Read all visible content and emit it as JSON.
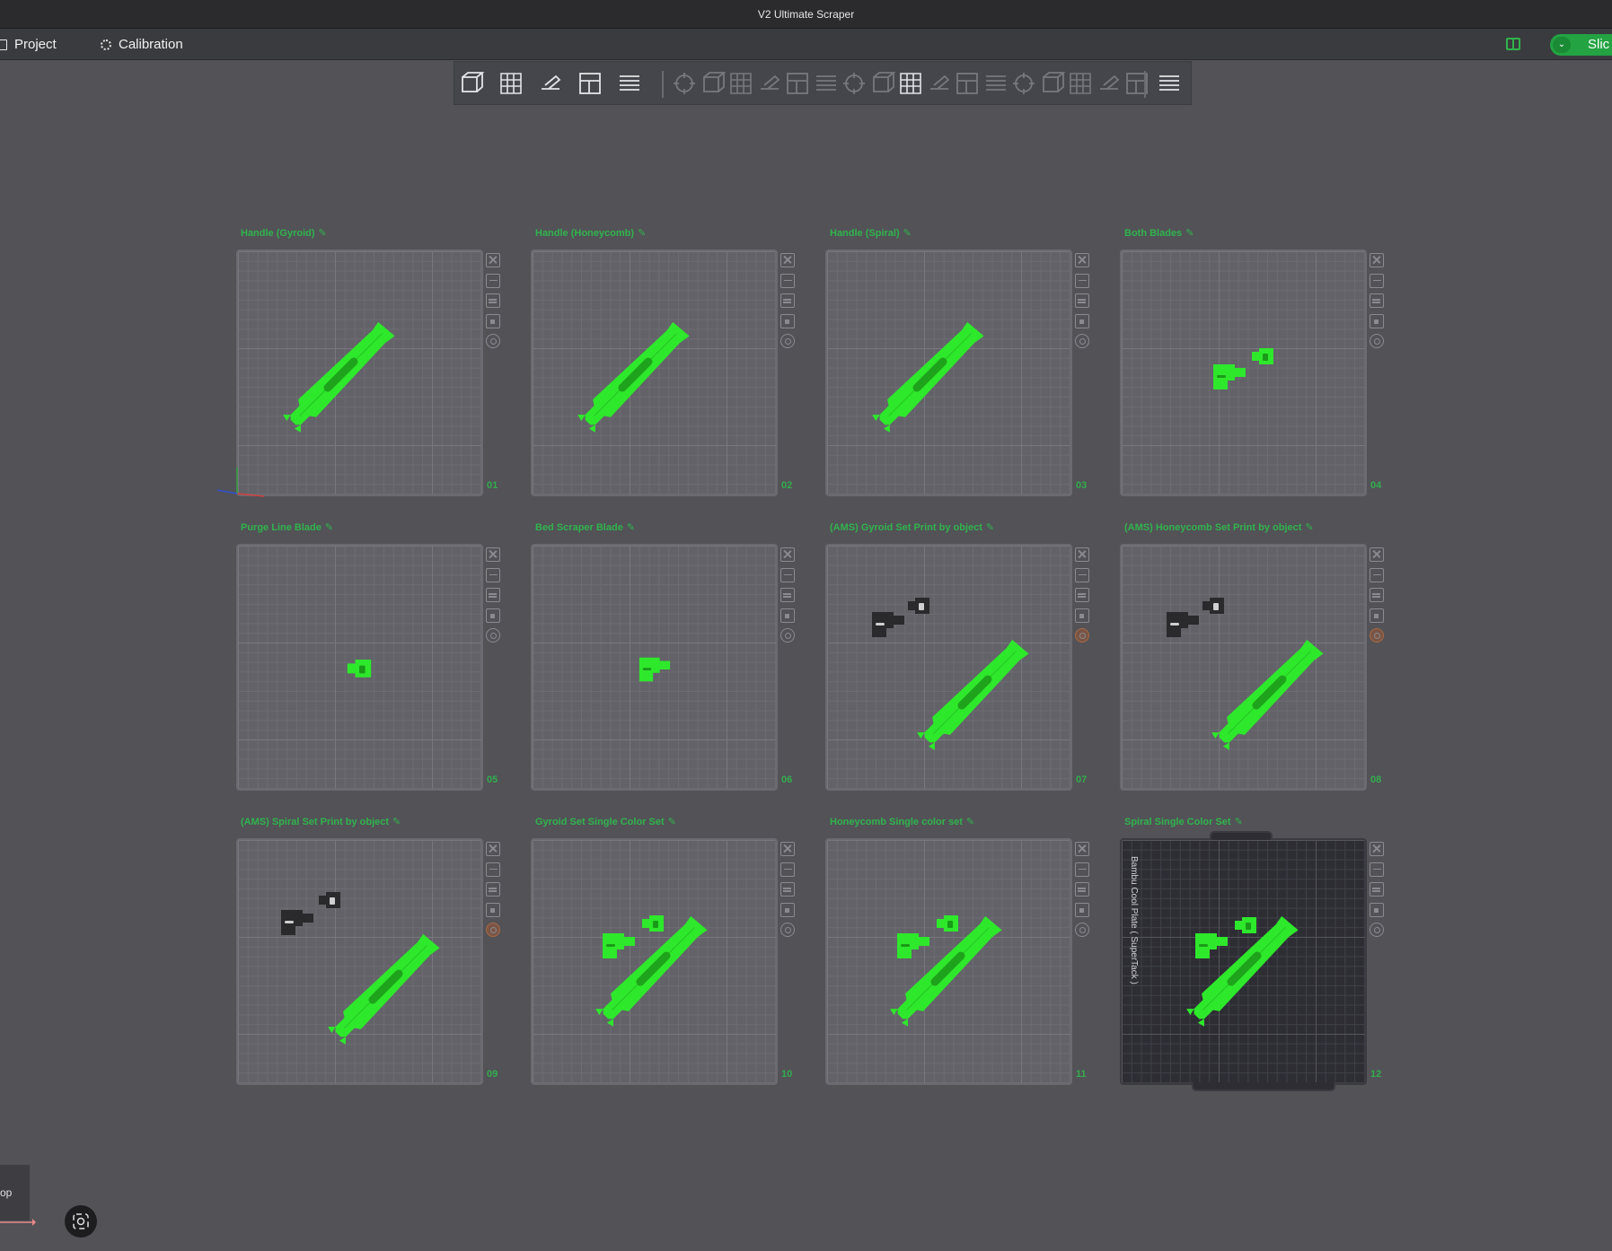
{
  "window": {
    "title": "V2 Ultimate Scraper"
  },
  "menu": {
    "project": "Project",
    "calibration": "Calibration",
    "slice": "Slic"
  },
  "toolbar": {
    "buttons": [
      "add-object-icon",
      "add-plate-icon",
      "auto-orient-icon",
      "arrange-icon",
      "split-layers-icon",
      "move-icon",
      "rotate-icon",
      "scale-icon",
      "lay-on-face-icon",
      "cut-icon",
      "boolean-icon",
      "support-paint-icon",
      "color-paint-icon",
      "text-icon",
      "measure-icon",
      "assembly-icon",
      "seam-icon",
      "mesh-icon",
      "fuzzy-skin-icon",
      "brim-ears-icon",
      "emboss-icon",
      "ruler-icon",
      "explode-icon"
    ]
  },
  "plates": [
    {
      "title": "Handle (Gyroid)",
      "num": "01"
    },
    {
      "title": "Handle (Honeycomb)",
      "num": "02"
    },
    {
      "title": "Handle (Spiral)",
      "num": "03"
    },
    {
      "title": "Both Blades",
      "num": "04"
    },
    {
      "title": "Purge Line Blade",
      "num": "05"
    },
    {
      "title": "Bed Scraper Blade",
      "num": "06"
    },
    {
      "title": "(AMS) Gyroid Set Print by object",
      "num": "07"
    },
    {
      "title": "(AMS) Honeycomb Set Print by object",
      "num": "08"
    },
    {
      "title": "(AMS) Spiral Set Print by object",
      "num": "09"
    },
    {
      "title": "Gyroid Set Single Color Set",
      "num": "10"
    },
    {
      "title": "Honeycomb Single color set",
      "num": "11"
    },
    {
      "title": "Spiral Single Color Set",
      "num": "12"
    }
  ],
  "bed_label": "Bambu Cool Plate ( SuperTack )",
  "view": {
    "label": "op",
    "axis": "x"
  },
  "colors": {
    "accent": "#23a342",
    "model_green": "#2ee82b",
    "model_dark": "#2a2a2c"
  }
}
